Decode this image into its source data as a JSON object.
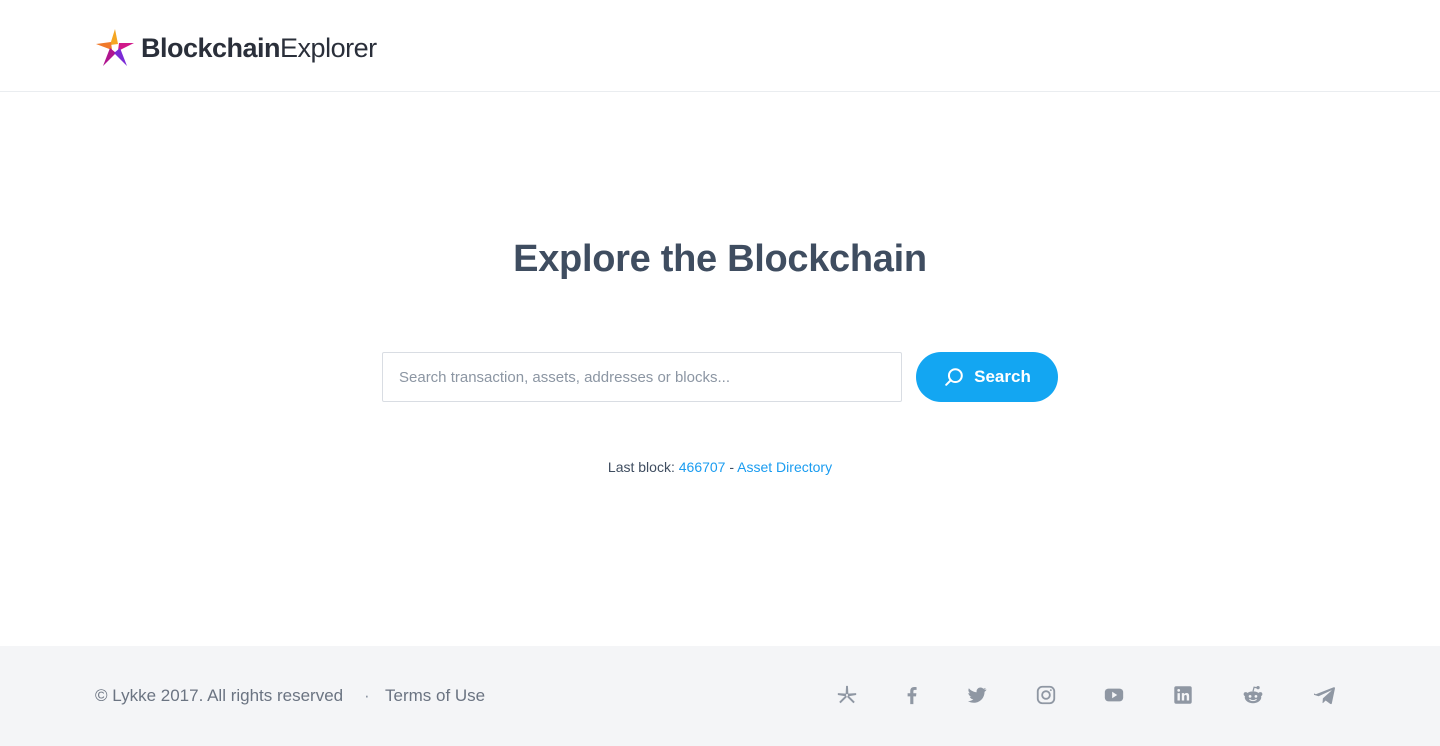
{
  "brand": {
    "name_bold": "Blockchain",
    "name_light": "Explorer",
    "colors": {
      "orange": "#f5a623",
      "magenta": "#d0198a",
      "purple": "#7b2bd6"
    }
  },
  "hero": {
    "title": "Explore the Blockchain"
  },
  "search": {
    "placeholder": "Search transaction, assets, addresses or blocks...",
    "value": "",
    "button_label": "Search",
    "button_icon": "search-icon",
    "accent": "#13a6f2"
  },
  "meta": {
    "last_block_label": "Last block:",
    "last_block_value": "466707",
    "separator": "-",
    "asset_directory_label": "Asset Directory"
  },
  "footer": {
    "copyright": "© Lykke 2017. All rights reserved",
    "separator": "·",
    "terms_label": "Terms of Use",
    "social": [
      {
        "icon": "lykke-icon"
      },
      {
        "icon": "facebook-icon"
      },
      {
        "icon": "twitter-icon"
      },
      {
        "icon": "instagram-icon"
      },
      {
        "icon": "youtube-icon"
      },
      {
        "icon": "linkedin-icon"
      },
      {
        "icon": "reddit-icon"
      },
      {
        "icon": "telegram-icon"
      }
    ]
  }
}
